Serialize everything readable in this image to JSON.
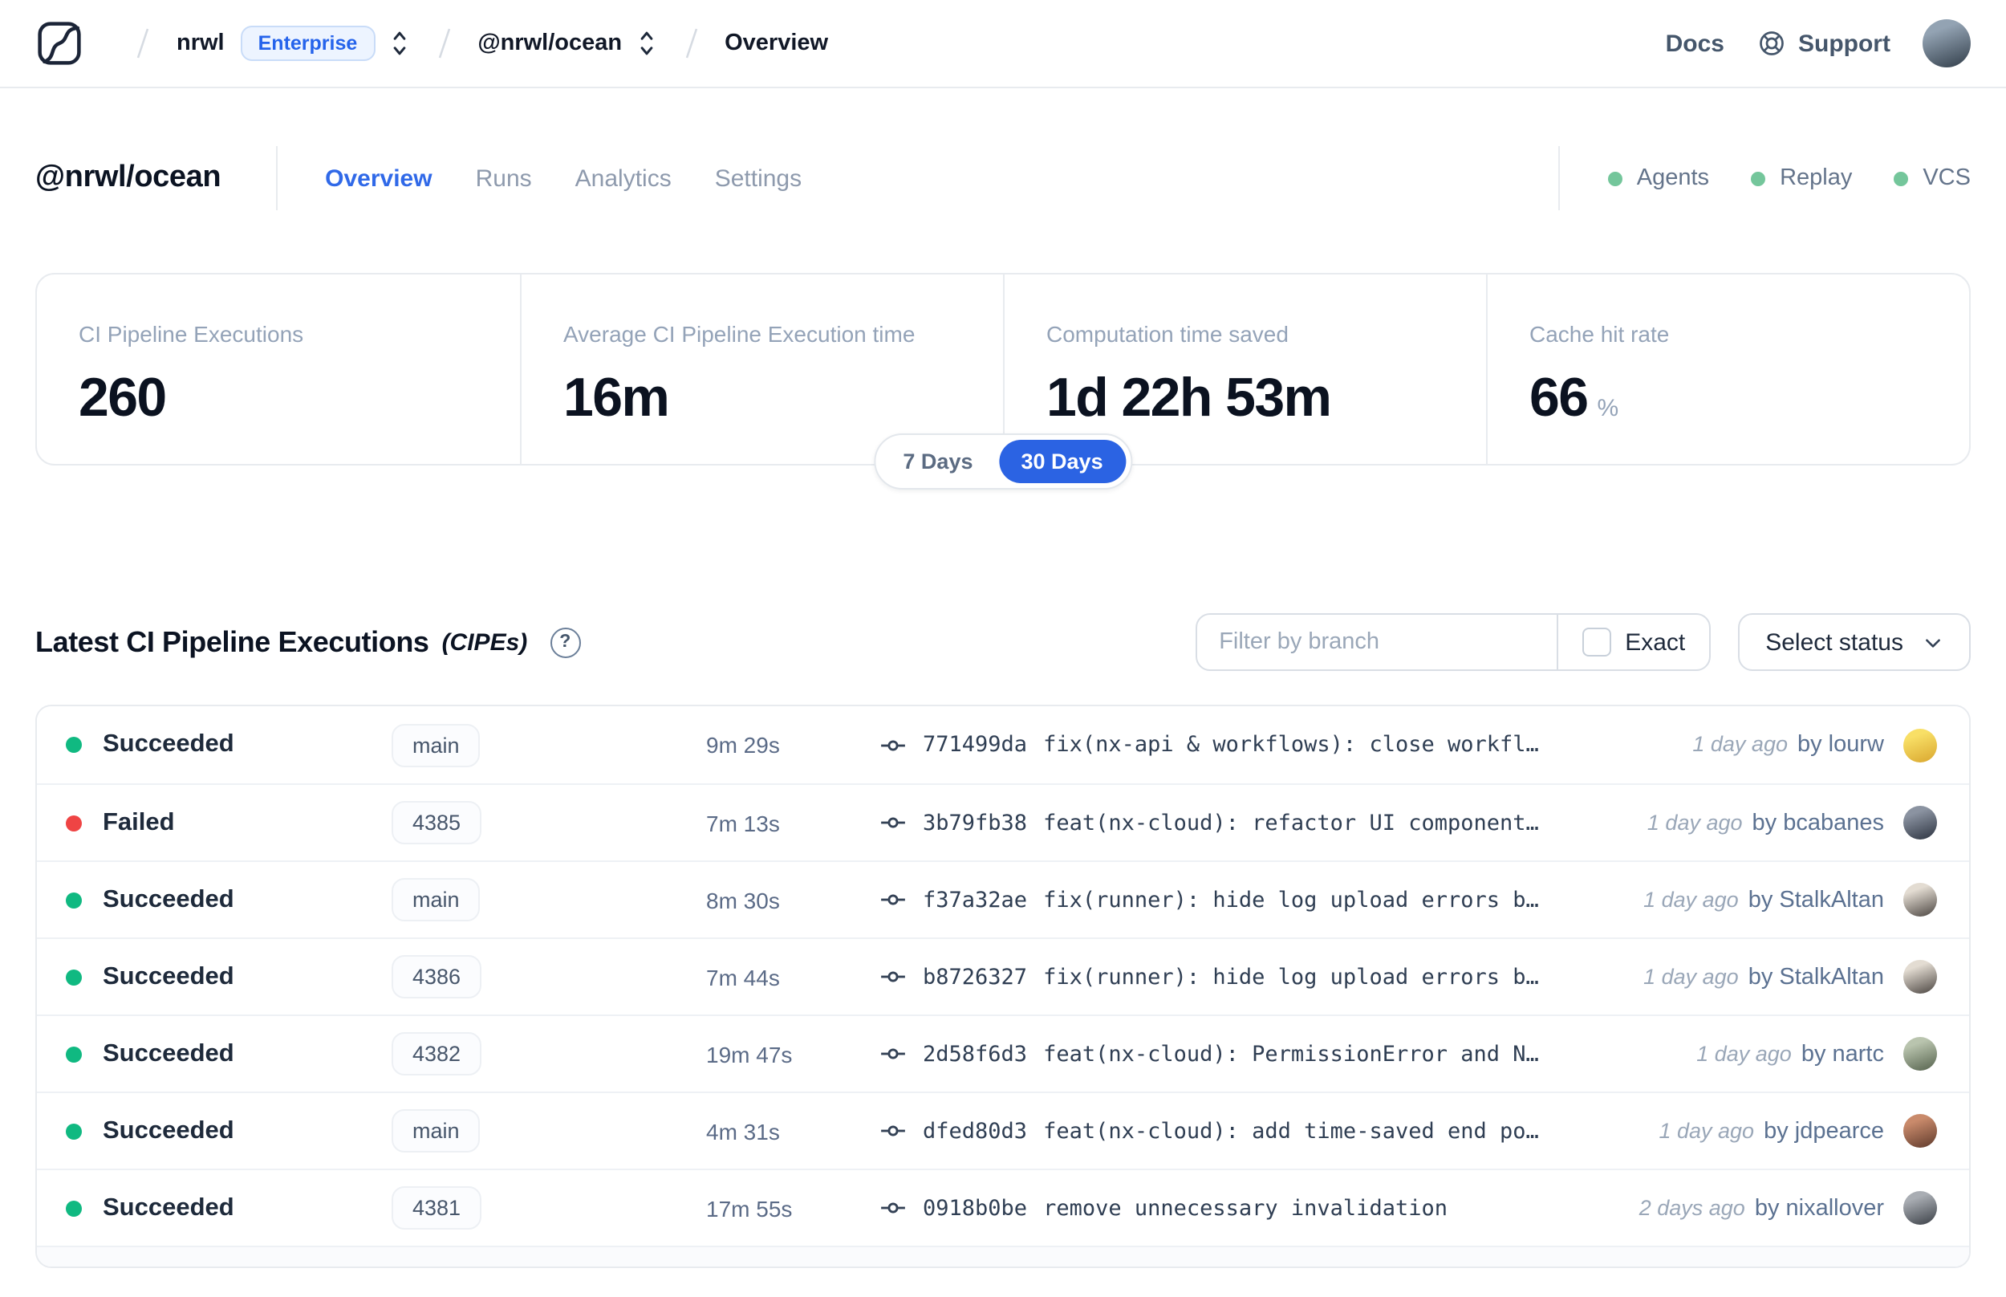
{
  "topbar": {
    "breadcrumb": {
      "org": "nrwl",
      "org_badge": "Enterprise",
      "workspace": "@nrwl/ocean",
      "page": "Overview"
    },
    "docs_label": "Docs",
    "support_label": "Support"
  },
  "header": {
    "title": "@nrwl/ocean",
    "tabs": [
      {
        "label": "Overview",
        "active": true
      },
      {
        "label": "Runs",
        "active": false
      },
      {
        "label": "Analytics",
        "active": false
      },
      {
        "label": "Settings",
        "active": false
      }
    ],
    "services": [
      {
        "label": "Agents"
      },
      {
        "label": "Replay"
      },
      {
        "label": "VCS"
      }
    ]
  },
  "stats": {
    "cards": [
      {
        "label": "CI Pipeline Executions",
        "value": "260",
        "suffix": ""
      },
      {
        "label": "Average CI Pipeline Execution time",
        "value": "16m",
        "suffix": ""
      },
      {
        "label": "Computation time saved",
        "value": "1d 22h 53m",
        "suffix": ""
      },
      {
        "label": "Cache hit rate",
        "value": "66",
        "suffix": "%"
      }
    ],
    "range": {
      "options": [
        "7 Days",
        "30 Days"
      ],
      "selected": "30 Days"
    }
  },
  "section": {
    "title": "Latest CI Pipeline Executions",
    "title_suffix": "(CIPEs)",
    "help_glyph": "?",
    "filter": {
      "placeholder": "Filter by branch",
      "exact_label": "Exact"
    },
    "status_select_label": "Select status"
  },
  "table": {
    "rows": [
      {
        "status": "Succeeded",
        "status_color": "#10b981",
        "branch": "main",
        "duration": "9m 29s",
        "commit": "771499da",
        "message": "fix(nx-api & workflows): close workfl…",
        "time": "1 day ago",
        "author": "by lourw",
        "avatar_from": "#f8df66",
        "avatar_to": "#d9a62e"
      },
      {
        "status": "Failed",
        "status_color": "#ef4444",
        "branch": "4385",
        "duration": "7m 13s",
        "commit": "3b79fb38",
        "message": "feat(nx-cloud): refactor UI component…",
        "time": "1 day ago",
        "author": "by bcabanes",
        "avatar_from": "#8b93a1",
        "avatar_to": "#2c3340"
      },
      {
        "status": "Succeeded",
        "status_color": "#10b981",
        "branch": "main",
        "duration": "8m 30s",
        "commit": "f37a32ae",
        "message": "fix(runner): hide log upload errors b…",
        "time": "1 day ago",
        "author": "by StalkAltan",
        "avatar_from": "#e3dcd2",
        "avatar_to": "#4a4440"
      },
      {
        "status": "Succeeded",
        "status_color": "#10b981",
        "branch": "4386",
        "duration": "7m 44s",
        "commit": "b8726327",
        "message": "fix(runner): hide log upload errors b…",
        "time": "1 day ago",
        "author": "by StalkAltan",
        "avatar_from": "#e3dcd2",
        "avatar_to": "#4a4440"
      },
      {
        "status": "Succeeded",
        "status_color": "#10b981",
        "branch": "4382",
        "duration": "19m 47s",
        "commit": "2d58f6d3",
        "message": "feat(nx-cloud): PermissionError and N…",
        "time": "1 day ago",
        "author": "by nartc",
        "avatar_from": "#b9c4ae",
        "avatar_to": "#55624d"
      },
      {
        "status": "Succeeded",
        "status_color": "#10b981",
        "branch": "main",
        "duration": "4m 31s",
        "commit": "dfed80d3",
        "message": "feat(nx-cloud): add time-saved end po…",
        "time": "1 day ago",
        "author": "by jdpearce",
        "avatar_from": "#c98a6b",
        "avatar_to": "#5f3a2c"
      },
      {
        "status": "Succeeded",
        "status_color": "#10b981",
        "branch": "4381",
        "duration": "17m 55s",
        "commit": "0918b0be",
        "message": "remove unnecessary invalidation",
        "time": "2 days ago",
        "author": "by nixallover",
        "avatar_from": "#a9adb3",
        "avatar_to": "#3a3f46"
      }
    ]
  },
  "user": {
    "avatar_from": "#93a3b3",
    "avatar_to": "#313d49"
  },
  "colors": {
    "accent_blue": "#3069e8",
    "selected_pill_blue": "#2b63e3",
    "success_green": "#10b981",
    "fail_red": "#ef4444",
    "service_green": "#74c69b",
    "enterprise_blue": "#2563eb"
  }
}
